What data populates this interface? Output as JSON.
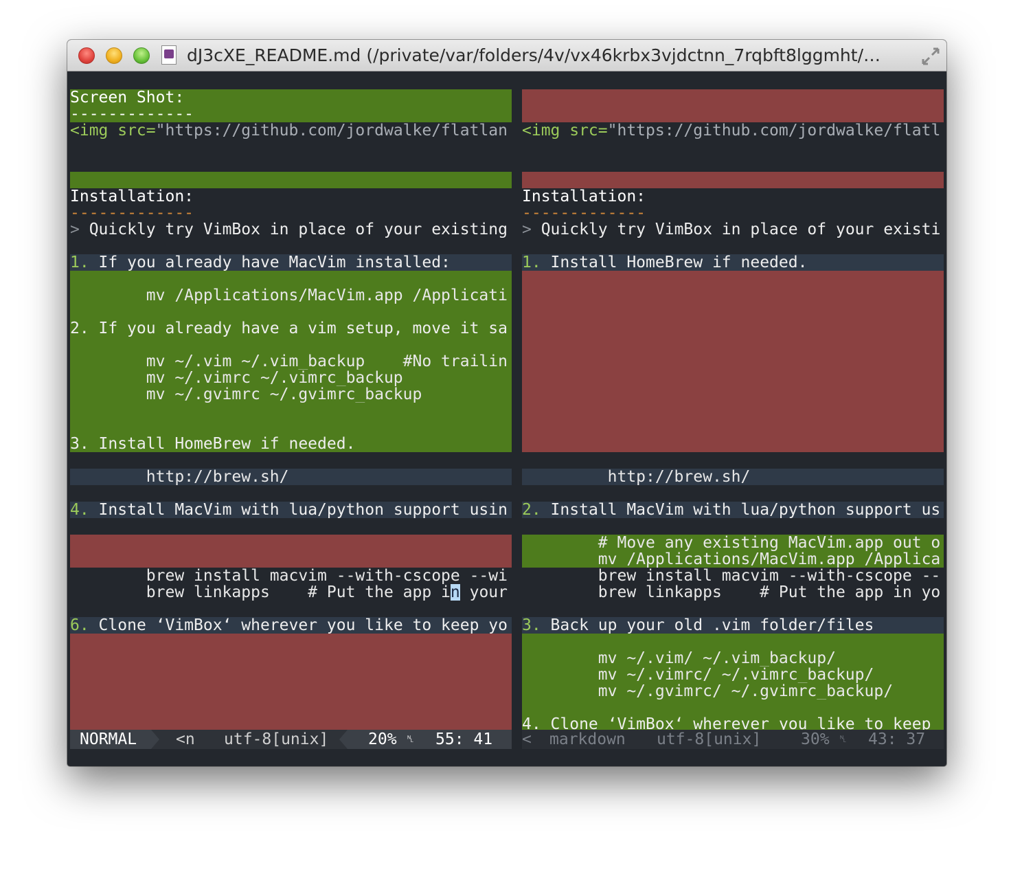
{
  "window": {
    "title": "dJ3cXE_README.md (/private/var/folders/4v/vx46krbx3vjdctnn_7rqbft8lggmht/…",
    "colors": {
      "added": "#4e7c1d",
      "deleted": "#8b4141",
      "changed": "#2f3a48",
      "background": "#23272d"
    }
  },
  "left": {
    "heading_screenshot": "Screen Shot:",
    "heading_underline": "-------------",
    "img_tag": "<img",
    "img_attr": " src=",
    "img_url": "\"https://github.com/jordwalke/flatlan",
    "heading_install": "Installation:",
    "install_underline": "-------------",
    "quote_marker": ">",
    "quote_text": " Quickly try VimBox in place of your existing",
    "item1_num": "1.",
    "item1_text": " If you already have MacVim installed:",
    "item1_code": "        mv /Applications/MacVim.app /Applicati",
    "item2": "2. If you already have a vim setup, move it sa",
    "code_vim": "        mv ~/.vim ~/.vim_backup    #No trailin",
    "code_vimrc": "        mv ~/.vimrc ~/.vimrc_backup",
    "code_gvimrc": "        mv ~/.gvimrc ~/.gvimrc_backup",
    "item3": "3. Install HomeBrew if needed.",
    "brew_url": "        http://brew.sh/",
    "item4_num": "4.",
    "item4_text": " Install MacVim with lua/python support usin",
    "brew_install": "        brew install macvim --with-cscope --wi",
    "brew_link_a": "        brew linkapps    # Put the app i",
    "brew_link_cursor": "n",
    "brew_link_b": " your",
    "item6_num": "6.",
    "item6_text": " Clone ‘VimBox‘ wherever you like to keep yo"
  },
  "right": {
    "img_tag": "<img",
    "img_attr": " src=",
    "img_url": "\"https://github.com/jordwalke/flatl",
    "heading_install": "Installation:",
    "install_underline": "-------------",
    "quote_marker": ">",
    "quote_text": " Quickly try VimBox in place of your existi",
    "item1_num": "1.",
    "item1_text": " Install HomeBrew if needed.",
    "brew_url": "         http://brew.sh/",
    "item2_num": "2.",
    "item2_text": " Install MacVim with lua/python support us",
    "comment_move": "        # Move any existing MacVim.app out o",
    "mv_app": "        mv /Applications/MacVim.app /Applica",
    "brew_install": "        brew install macvim --with-cscope --",
    "brew_link": "        brew linkapps    # Put the app in yo",
    "item3_num": "3.",
    "item3_text": " Back up your old .vim folder/files",
    "mv_vim": "        mv ~/.vim/ ~/.vim_backup/",
    "mv_vimrc": "        mv ~/.vimrc/ ~/.vimrc_backup/",
    "mv_gvimrc": "        mv ~/.gvimrc/ ~/.gvimrc_backup/",
    "item4": "4. Clone ‘VimBox‘ wherever you like to keep"
  },
  "status_left": {
    "mode": "NORMAL",
    "branch": "<n",
    "encoding": "utf-8[unix]",
    "percent": "20%",
    "ln_symbol": "␤",
    "position": "55: 41"
  },
  "status_right": {
    "branch": "<",
    "filetype": "markdown",
    "encoding": "utf-8[unix]",
    "percent": "30%",
    "ln_symbol": "␤",
    "position": "43: 37"
  }
}
